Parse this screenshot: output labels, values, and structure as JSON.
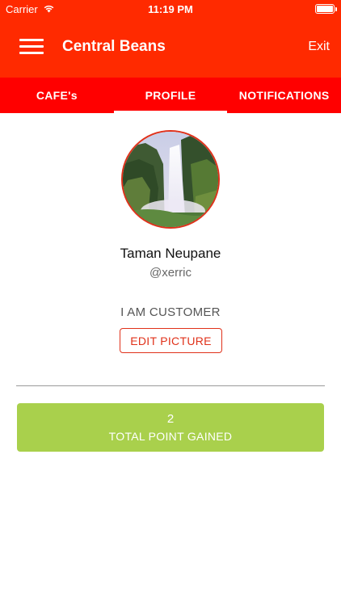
{
  "status_bar": {
    "carrier": "Carrier",
    "time": "11:19 PM"
  },
  "header": {
    "title": "Central Beans",
    "exit_label": "Exit"
  },
  "tabs": [
    {
      "label": "CAFE's",
      "active": false
    },
    {
      "label": "PROFILE",
      "active": true
    },
    {
      "label": "NOTIFICATIONS",
      "active": false
    }
  ],
  "profile": {
    "name": "Taman Neupane",
    "handle": "@xerric",
    "role": "I AM CUSTOMER",
    "edit_picture_label": "EDIT PICTURE"
  },
  "points": {
    "value": "2",
    "label": "TOTAL POINT GAINED"
  },
  "colors": {
    "header_red": "#ff2a00",
    "tab_red": "#ff0000",
    "accent_red": "#e0311a",
    "points_green": "#a9d04c"
  }
}
